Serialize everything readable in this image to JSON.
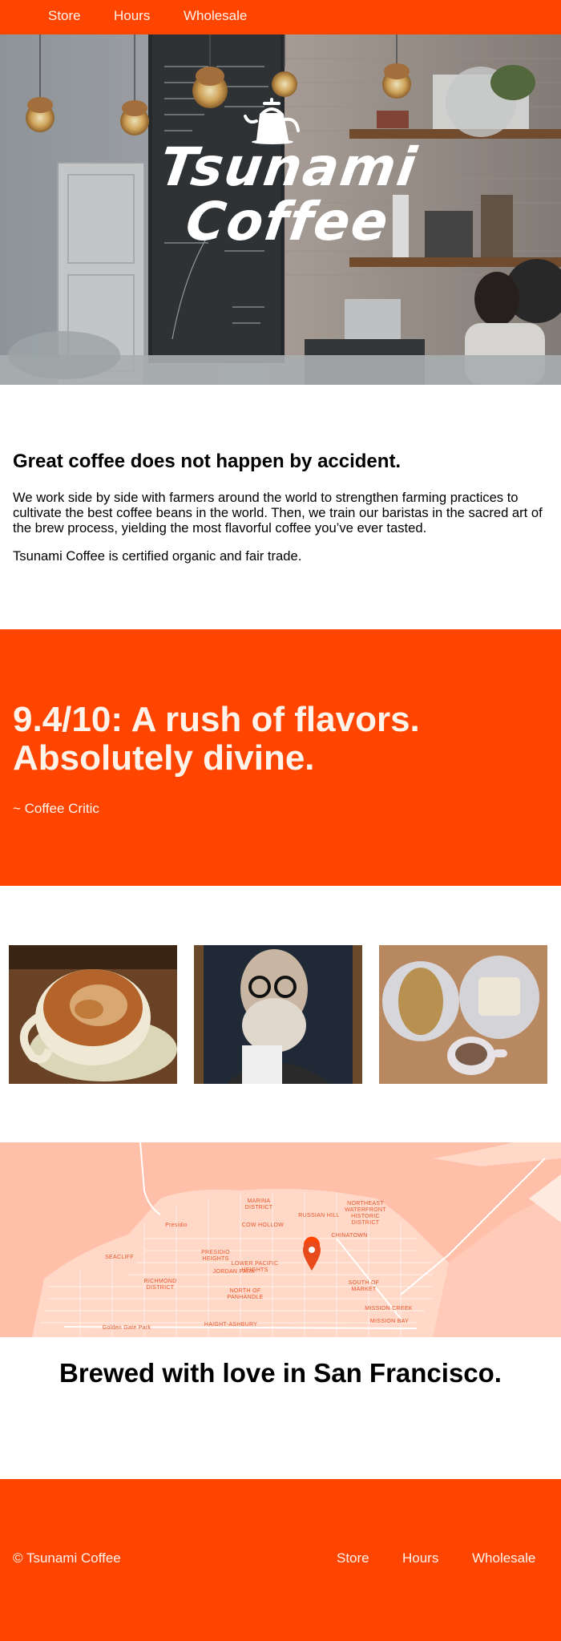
{
  "nav": {
    "store": "Store",
    "hours": "Hours",
    "wholesale": "Wholesale"
  },
  "hero": {
    "logo_line1": "Tsunami",
    "logo_line2": "Coffee",
    "logo_icon": "pour-over-kettle-icon"
  },
  "intro": {
    "heading": "Great coffee does not happen by accident.",
    "paragraph1": "We work side by side with farmers around the world to strengthen farming practices to cultivate the best coffee beans in the world. Then, we train our baristas in the sacred art of the brew process, yielding the most flavorful coffee you’ve ever tasted.",
    "paragraph2": "Tsunami Coffee is certified organic and fair trade."
  },
  "review": {
    "quote": "9.4/10: A rush of flavors. Absolutely divine.",
    "critic": "~ Coffee Critic"
  },
  "map": {
    "labels": {
      "marina": "MARINA\nDISTRICT",
      "northeast": "NORTHEAST\nWATERFRONT\nHISTORIC\nDISTRICT",
      "russian_hill": "RUSSIAN HILL",
      "presidio": "Presidio",
      "cow_hollow": "COW HOLLOW",
      "chinatown": "CHINATOWN",
      "seacliff": "SEACLIFF",
      "presidio_heights": "PRESIDIO\nHEIGHTS",
      "lower_pacific": "LOWER PACIFIC\nHEIGHTS",
      "jordan_park": "JORDAN PARK",
      "richmond": "RICHMOND\nDISTRICT",
      "north_panhandle": "NORTH OF\nPANHANDLE",
      "south_market": "SOUTH OF\nMARKET",
      "mission_creek": "MISSION CREEK",
      "mission_bay": "MISSION BAY",
      "golden_gate": "Golden Gate Park",
      "haight": "HAIGHT-ASHBURY"
    },
    "pin_icon": "map-pin-icon",
    "accent": "#ff4500"
  },
  "brewed": {
    "heading": "Brewed with love in San Francisco."
  },
  "footer": {
    "copyright": "© Tsunami Coffee",
    "store": "Store",
    "hours": "Hours",
    "wholesale": "Wholesale"
  },
  "colors": {
    "brand": "#ff4500",
    "light_text": "#fff3ea",
    "map_bg": "#ffbfa8"
  }
}
